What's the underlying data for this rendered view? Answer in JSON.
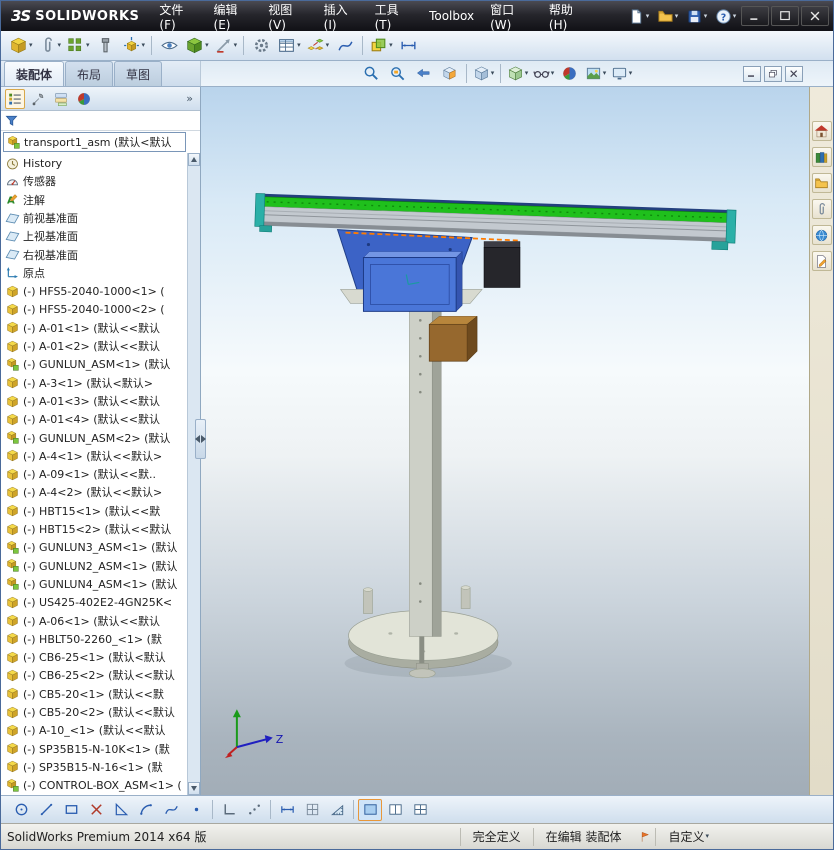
{
  "titlebar": {
    "logo": {
      "mark": "3S",
      "text": "SOLIDWORKS"
    },
    "menus": [
      {
        "name": "menu-file",
        "label": "文件(F)"
      },
      {
        "name": "menu-edit",
        "label": "编辑(E)"
      },
      {
        "name": "menu-view",
        "label": "视图(V)"
      },
      {
        "name": "menu-insert",
        "label": "插入(I)"
      },
      {
        "name": "menu-tools",
        "label": "工具(T)"
      },
      {
        "name": "menu-toolbox",
        "label": "Toolbox"
      },
      {
        "name": "menu-window",
        "label": "窗口(W)"
      },
      {
        "name": "menu-help",
        "label": "帮助(H)"
      }
    ],
    "quick_icons": [
      {
        "name": "new-document",
        "icon": "new_doc",
        "dd": true
      },
      {
        "name": "open-document",
        "icon": "open_folder",
        "dd": true
      },
      {
        "name": "save-document",
        "icon": "save",
        "dd": true
      },
      {
        "name": "help",
        "icon": "help",
        "dd": true
      }
    ],
    "window_buttons": [
      {
        "name": "window-minimize",
        "icon": "win_min"
      },
      {
        "name": "window-maximize",
        "icon": "win_max"
      },
      {
        "name": "window-close",
        "icon": "win_close"
      }
    ]
  },
  "toolbar": {
    "items": [
      {
        "name": "insert-components",
        "icon": "cube_yellow",
        "dd": true
      },
      {
        "name": "mate",
        "icon": "clip",
        "dd": true
      },
      {
        "name": "linear-component-pattern",
        "icon": "pattern",
        "dd": true
      },
      {
        "name": "smart-fasteners",
        "icon": "bolt"
      },
      {
        "name": "move-component",
        "icon": "move_cube",
        "dd": true
      },
      {
        "type": "sep"
      },
      {
        "name": "show-hidden-components",
        "icon": "eye"
      },
      {
        "name": "assembly-features",
        "icon": "cube_green",
        "dd": true
      },
      {
        "name": "reference-geometry",
        "icon": "ref_geom",
        "dd": true
      },
      {
        "type": "sep"
      },
      {
        "name": "new-motion-study",
        "icon": "motion"
      },
      {
        "name": "bill-of-materials",
        "icon": "table",
        "dd": true
      },
      {
        "name": "exploded-view",
        "icon": "explode",
        "dd": true
      },
      {
        "name": "explode-line-sketch",
        "icon": "spline_tool"
      },
      {
        "type": "sep"
      },
      {
        "name": "interference-detection",
        "icon": "cube_pair",
        "dd": true
      },
      {
        "name": "instant-3d",
        "icon": "dim_tool"
      }
    ]
  },
  "tabs": {
    "items": [
      {
        "name": "tab-assembly",
        "label": "装配体",
        "active": true
      },
      {
        "name": "tab-layout",
        "label": "布局"
      },
      {
        "name": "tab-sketch",
        "label": "草图"
      }
    ]
  },
  "headsup": {
    "items": [
      {
        "name": "zoom-to-fit",
        "icon": "magnifier"
      },
      {
        "name": "zoom-to-area",
        "icon": "magnifier_area"
      },
      {
        "name": "previous-view",
        "icon": "prev_view"
      },
      {
        "name": "section-view",
        "icon": "section"
      },
      {
        "type": "sep"
      },
      {
        "name": "view-orientation",
        "icon": "cube_view",
        "dd": true
      },
      {
        "type": "sep"
      },
      {
        "name": "display-style",
        "icon": "display_style",
        "dd": true
      },
      {
        "name": "hide-show-items",
        "icon": "glasses",
        "dd": true
      },
      {
        "name": "edit-appearance",
        "icon": "ball"
      },
      {
        "name": "apply-scene",
        "icon": "scene",
        "dd": true
      },
      {
        "name": "view-settings",
        "icon": "monitor",
        "dd": true
      }
    ]
  },
  "docwin": {
    "buttons": [
      {
        "name": "document-minimize",
        "icon": "win_min2"
      },
      {
        "name": "document-restore",
        "icon": "win_restore"
      },
      {
        "name": "document-close",
        "icon": "win_close2"
      }
    ]
  },
  "panel": {
    "header_icons": [
      {
        "name": "featuremanager-tab",
        "icon": "fm_tree",
        "pressed": true
      },
      {
        "name": "propertymanager-tab",
        "icon": "prop_mgr"
      },
      {
        "name": "configurationmanager-tab",
        "icon": "config_mgr"
      },
      {
        "name": "displaymanager-tab",
        "icon": "ball"
      }
    ],
    "overflow_label": "»",
    "root": {
      "icon": "assembly_sm",
      "text": "transport1_asm (默认<默认"
    },
    "items": [
      {
        "icon": "history",
        "text": "History"
      },
      {
        "icon": "sensor",
        "text": "传感器"
      },
      {
        "icon": "annotation",
        "text": "注解"
      },
      {
        "icon": "plane",
        "text": "前视基准面"
      },
      {
        "icon": "plane",
        "text": "上视基准面"
      },
      {
        "icon": "plane",
        "text": "右视基准面"
      },
      {
        "icon": "origin",
        "text": "原点"
      },
      {
        "icon": "part_sm",
        "text": "(-) HFS5-2040-1000<1> ("
      },
      {
        "icon": "part_sm",
        "text": "(-) HFS5-2040-1000<2> ("
      },
      {
        "icon": "part_sm",
        "text": "(-) A-01<1> (默认<<默认"
      },
      {
        "icon": "part_sm",
        "text": "(-) A-01<2> (默认<<默认"
      },
      {
        "icon": "assembly_sm",
        "text": "(-) GUNLUN_ASM<1> (默认"
      },
      {
        "icon": "part_sm",
        "text": "(-) A-3<1> (默认<默认>"
      },
      {
        "icon": "part_sm",
        "text": "(-) A-01<3> (默认<<默认"
      },
      {
        "icon": "part_sm",
        "text": "(-) A-01<4> (默认<<默认"
      },
      {
        "icon": "assembly_sm",
        "text": "(-) GUNLUN_ASM<2> (默认"
      },
      {
        "icon": "part_sm",
        "text": "(-) A-4<1> (默认<<默认>"
      },
      {
        "icon": "part_sm",
        "text": "(-) A-09<1> (默认<<默.."
      },
      {
        "icon": "part_sm",
        "text": "(-) A-4<2> (默认<<默认>"
      },
      {
        "icon": "part_sm",
        "text": "(-) HBT15<1> (默认<<默"
      },
      {
        "icon": "part_sm",
        "text": "(-) HBT15<2> (默认<<默认"
      },
      {
        "icon": "assembly_sm",
        "text": "(-) GUNLUN3_ASM<1> (默认"
      },
      {
        "icon": "assembly_sm",
        "text": "(-) GUNLUN2_ASM<1> (默认"
      },
      {
        "icon": "assembly_sm",
        "text": "(-) GUNLUN4_ASM<1> (默认"
      },
      {
        "icon": "part_sm",
        "text": "(-) US425-402E2-4GN25K<"
      },
      {
        "icon": "part_sm",
        "text": "(-) A-06<1> (默认<<默认"
      },
      {
        "icon": "part_sm",
        "text": "(-) HBLT50-2260_<1> (默"
      },
      {
        "icon": "part_sm",
        "text": "(-) CB6-25<1> (默认<默认"
      },
      {
        "icon": "part_sm",
        "text": "(-) CB6-25<2> (默认<<默认"
      },
      {
        "icon": "part_sm",
        "text": "(-) CB5-20<1> (默认<<默"
      },
      {
        "icon": "part_sm",
        "text": "(-) CB5-20<2> (默认<<默认"
      },
      {
        "icon": "part_sm",
        "text": "(-) A-10_<1> (默认<<默认"
      },
      {
        "icon": "part_sm",
        "text": "(-) SP35B15-N-10K<1> (默"
      },
      {
        "icon": "part_sm",
        "text": "(-) SP35B15-N-16<1> (默"
      },
      {
        "icon": "assembly_sm",
        "text": "(-) CONTROL-BOX_ASM<1> ("
      }
    ]
  },
  "viewport": {
    "triad_label": "Z"
  },
  "taskpane": {
    "items": [
      {
        "name": "solidworks-resources",
        "icon": "house"
      },
      {
        "name": "design-library",
        "icon": "book"
      },
      {
        "name": "file-explorer",
        "icon": "folder_sm"
      },
      {
        "name": "view-palette",
        "icon": "clip"
      },
      {
        "name": "appearances-scenes",
        "icon": "globe"
      },
      {
        "name": "custom-properties",
        "icon": "doc_edit"
      }
    ]
  },
  "bottom": {
    "items": [
      {
        "name": "sketch-circle",
        "icon": "circle_tool"
      },
      {
        "name": "sketch-line",
        "icon": "line_tool"
      },
      {
        "name": "sketch-rectangle",
        "icon": "rect_tool"
      },
      {
        "name": "trim-entities",
        "icon": "x_tool"
      },
      {
        "name": "sketch-chamfer",
        "icon": "angle_tool"
      },
      {
        "name": "sketch-arc",
        "icon": "arc_tool"
      },
      {
        "name": "sketch-spline",
        "icon": "spline_tool"
      },
      {
        "name": "sketch-point",
        "icon": "point_tool"
      },
      {
        "type": "sep"
      },
      {
        "name": "corner-snap",
        "icon": "corner_tool"
      },
      {
        "name": "quick-snaps",
        "icon": "dots_tool"
      },
      {
        "type": "sep"
      },
      {
        "name": "smart-dimension",
        "icon": "dim_tool"
      },
      {
        "name": "grid-settings",
        "icon": "grid_tool"
      },
      {
        "name": "measure-tool",
        "icon": "ruler_tool"
      },
      {
        "type": "sep"
      },
      {
        "name": "single-viewport",
        "icon": "view1_tool",
        "active": true
      },
      {
        "name": "two-viewport",
        "icon": "view2_tool"
      },
      {
        "name": "four-viewport",
        "icon": "view4_tool"
      }
    ]
  },
  "statusbar": {
    "left": "SolidWorks Premium 2014 x64 版",
    "defined": "完全定义",
    "editing": "在编辑 装配体",
    "custom": "自定义"
  }
}
